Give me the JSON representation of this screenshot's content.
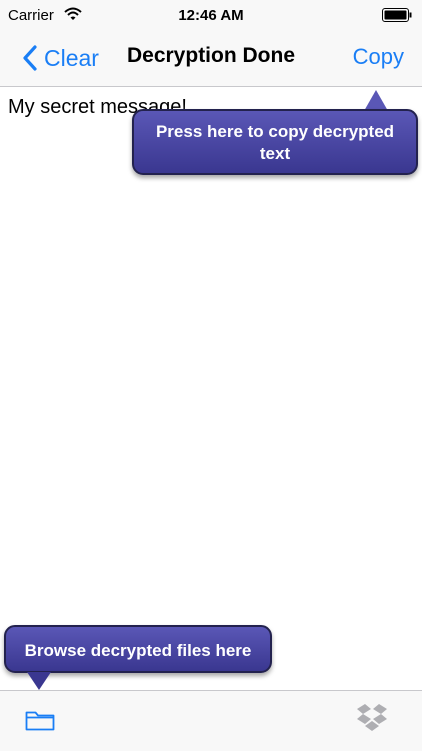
{
  "status_bar": {
    "carrier": "Carrier",
    "time": "12:46 AM",
    "wifi_icon": "wifi-icon",
    "battery_icon": "battery-icon"
  },
  "nav_bar": {
    "back_label": "Clear",
    "back_icon": "chevron-left-icon",
    "title": "Decryption Done",
    "action_label": "Copy",
    "accent_color": "#1a7ef5"
  },
  "content": {
    "text": "My secret message!"
  },
  "tooltips": {
    "copy_hint": "Press here to copy decrypted text",
    "browse_hint": "Browse decrypted files here",
    "background_color": "#4a47a3"
  },
  "toolbar": {
    "left_icon": "folder-icon",
    "right_icon": "dropbox-icon"
  }
}
